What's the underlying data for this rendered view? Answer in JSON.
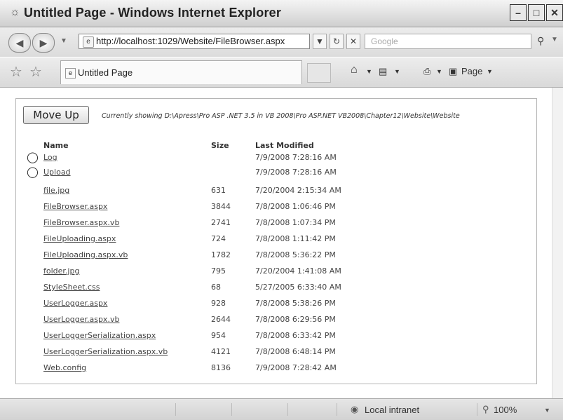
{
  "window": {
    "title": "Untitled Page - Windows Internet Explorer"
  },
  "address_bar": {
    "url": "http://localhost:1029/Website/FileBrowser.aspx",
    "search_placeholder": "Google"
  },
  "tab": {
    "label": "Untitled Page"
  },
  "command_bar": {
    "page_label": "Page"
  },
  "browser": {
    "move_up_label": "Move Up",
    "showing_text": "Currently showing D:\\Apress\\Pro ASP .NET 3.5 in VB 2008\\Pro ASP.NET VB2008\\Chapter12\\Website\\Website",
    "columns": {
      "name": "Name",
      "size": "Size",
      "modified": "Last Modified"
    },
    "folders": [
      {
        "name": "Log",
        "modified": "7/9/2008 7:28:16 AM"
      },
      {
        "name": "Upload",
        "modified": "7/9/2008 7:28:16 AM"
      }
    ],
    "files": [
      {
        "name": "file.jpg",
        "size": "631",
        "modified": "7/20/2004 2:15:34 AM"
      },
      {
        "name": "FileBrowser.aspx",
        "size": "3844",
        "modified": "7/8/2008 1:06:46 PM"
      },
      {
        "name": "FileBrowser.aspx.vb",
        "size": "2741",
        "modified": "7/8/2008 1:07:34 PM"
      },
      {
        "name": "FileUploading.aspx",
        "size": "724",
        "modified": "7/8/2008 1:11:42 PM"
      },
      {
        "name": "FileUploading.aspx.vb",
        "size": "1782",
        "modified": "7/8/2008 5:36:22 PM"
      },
      {
        "name": "folder.jpg",
        "size": "795",
        "modified": "7/20/2004 1:41:08 AM"
      },
      {
        "name": "StyleSheet.css",
        "size": "68",
        "modified": "5/27/2005 6:33:40 AM"
      },
      {
        "name": "UserLogger.aspx",
        "size": "928",
        "modified": "7/8/2008 5:38:26 PM"
      },
      {
        "name": "UserLogger.aspx.vb",
        "size": "2644",
        "modified": "7/8/2008 6:29:56 PM"
      },
      {
        "name": "UserLoggerSerialization.aspx",
        "size": "954",
        "modified": "7/8/2008 6:33:42 PM"
      },
      {
        "name": "UserLoggerSerialization.aspx.vb",
        "size": "4121",
        "modified": "7/8/2008 6:48:14 PM"
      },
      {
        "name": "Web.config",
        "size": "8136",
        "modified": "7/9/2008 7:28:42 AM"
      }
    ]
  },
  "status": {
    "zone": "Local intranet",
    "zoom": "100%"
  }
}
